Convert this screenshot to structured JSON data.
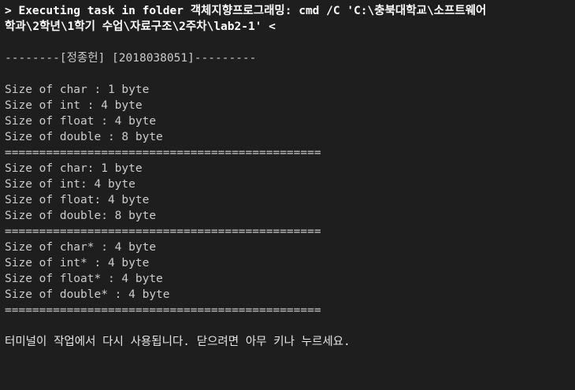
{
  "task_header": {
    "line1": "> Executing task in folder 객체지향프로그래밍: cmd /C 'C:\\충북대학교\\소프트웨어",
    "line2": "학과\\2학년\\1학기 수업\\자료구조\\2주차\\lab2-1' <"
  },
  "banner": "--------[정종헌] [2018038051]---------",
  "section1": [
    "Size of char : 1 byte",
    "Size of int : 4 byte",
    "Size of float : 4 byte",
    "Size of double : 8 byte"
  ],
  "separator": "==============================================",
  "section2": [
    "Size of char: 1 byte",
    "Size of int: 4 byte",
    "Size of float: 4 byte",
    "Size of double: 8 byte"
  ],
  "section3": [
    "Size of char* : 4 byte",
    "Size of int* : 4 byte",
    "Size of float* : 4 byte",
    "Size of double* : 4 byte"
  ],
  "footer_message": "터미널이 작업에서 다시 사용됩니다. 닫으려면 아무 키나 누르세요."
}
